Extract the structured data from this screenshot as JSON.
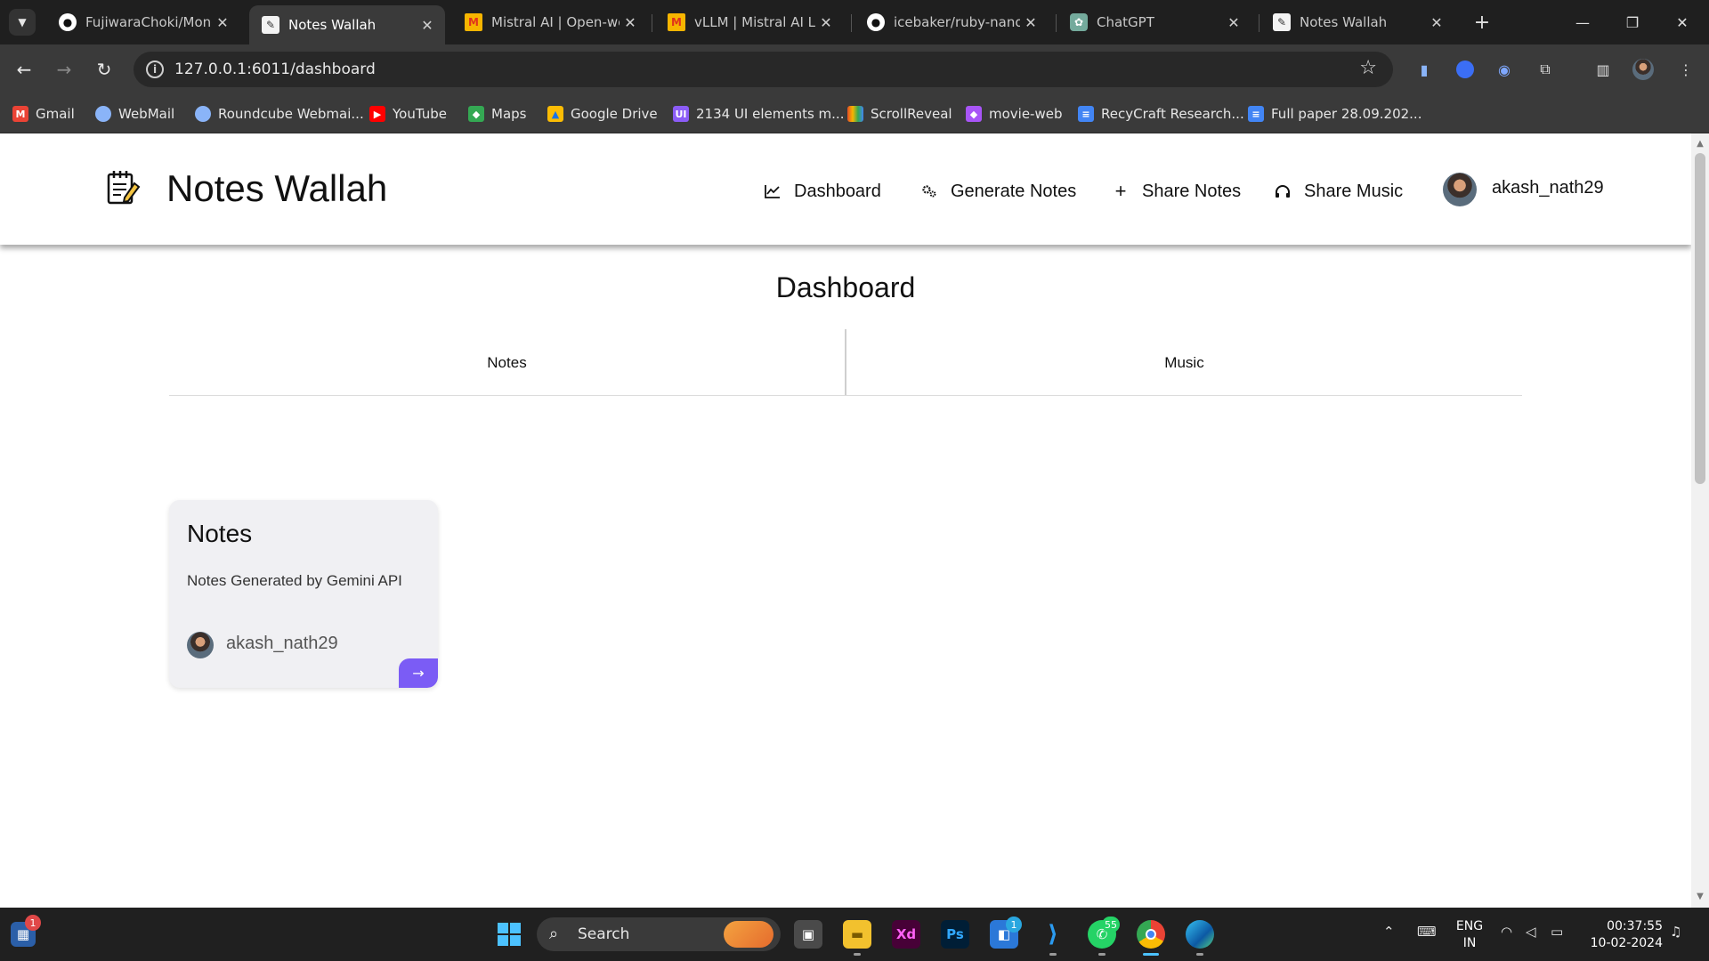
{
  "browser": {
    "tabs": [
      {
        "label": "FujiwaraChoki/Money",
        "icon": "github-icon",
        "active": false
      },
      {
        "label": "Notes Wallah",
        "icon": "notes-wallah-favicon",
        "active": true
      },
      {
        "label": "Mistral AI | Open-wei",
        "icon": "mistral-icon",
        "active": false
      },
      {
        "label": "vLLM | Mistral AI Larg",
        "icon": "mistral-icon",
        "active": false
      },
      {
        "label": "icebaker/ruby-nano-",
        "icon": "github-icon",
        "active": false
      },
      {
        "label": "ChatGPT",
        "icon": "chatgpt-icon",
        "active": false
      },
      {
        "label": "Notes Wallah",
        "icon": "notes-wallah-favicon",
        "active": false
      }
    ],
    "url": "127.0.0.1:6011/dashboard",
    "bookmarks": [
      {
        "label": "Gmail",
        "icon": "gmail-icon",
        "color": "#ea4335"
      },
      {
        "label": "WebMail",
        "icon": "webmail-icon",
        "color": "#8ab4f8"
      },
      {
        "label": "Roundcube Webmai...",
        "icon": "roundcube-icon",
        "color": "#8ab4f8"
      },
      {
        "label": "YouTube",
        "icon": "youtube-icon",
        "color": "#ff0000"
      },
      {
        "label": "Maps",
        "icon": "maps-icon",
        "color": "#34a853"
      },
      {
        "label": "Google Drive",
        "icon": "google-drive-icon",
        "color": "#fbbc04"
      },
      {
        "label": "2134 UI elements m...",
        "icon": "uiverse-icon",
        "color": "#8b5cf6"
      },
      {
        "label": "ScrollReveal",
        "icon": "scrollreveal-icon",
        "color": "#e44d26"
      },
      {
        "label": "movie-web",
        "icon": "movie-web-icon",
        "color": "#a855f7"
      },
      {
        "label": "RecyCraft Research...",
        "icon": "google-docs-icon",
        "color": "#4285f4"
      },
      {
        "label": "Full paper 28.09.202...",
        "icon": "google-docs-icon",
        "color": "#4285f4"
      }
    ]
  },
  "site": {
    "brand": "Notes Wallah",
    "nav": [
      {
        "label": "Dashboard",
        "icon": "chart-line-icon"
      },
      {
        "label": "Generate Notes",
        "icon": "gears-icon"
      },
      {
        "label": "Share Notes",
        "icon": "plus-icon"
      },
      {
        "label": "Share Music",
        "icon": "headphones-icon"
      }
    ],
    "username": "akash_nath29"
  },
  "dashboard": {
    "title": "Dashboard",
    "tabs": [
      "Notes",
      "Music"
    ],
    "cards": [
      {
        "title": "Notes",
        "description": "Notes Generated by Gemini API",
        "author": "akash_nath29",
        "accent": "#7b5cf5"
      }
    ]
  },
  "taskbar": {
    "search_label": "Search",
    "notification_badge": "1",
    "store_badge": "1",
    "whatsapp_badge": "55",
    "language": [
      "ENG",
      "IN"
    ],
    "time": "00:37:55",
    "date": "10-02-2024"
  }
}
